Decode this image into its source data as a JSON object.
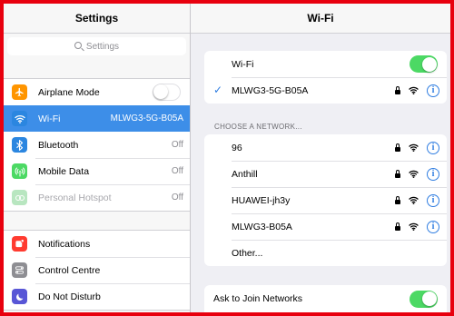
{
  "sidebar": {
    "title": "Settings",
    "search_placeholder": "Settings",
    "group1": [
      {
        "label": "Airplane Mode",
        "value": "",
        "icon": "airplane-icon",
        "color": "#ff9500",
        "toggle": "off"
      },
      {
        "label": "Wi-Fi",
        "value": "MLWG3-5G-B05A",
        "icon": "wifi-icon",
        "color": "#2b86e0",
        "selected": true
      },
      {
        "label": "Bluetooth",
        "value": "Off",
        "icon": "bluetooth-icon",
        "color": "#2b86e0"
      },
      {
        "label": "Mobile Data",
        "value": "Off",
        "icon": "antenna-icon",
        "color": "#4cd964"
      },
      {
        "label": "Personal Hotspot",
        "value": "Off",
        "icon": "hotspot-icon",
        "color": "#b8e6c0",
        "disabled": true
      }
    ],
    "group2": [
      {
        "label": "Notifications",
        "icon": "notifications-icon",
        "color": "#ff3b30"
      },
      {
        "label": "Control Centre",
        "icon": "control-centre-icon",
        "color": "#8e8e93"
      },
      {
        "label": "Do Not Disturb",
        "icon": "moon-icon",
        "color": "#5856d6"
      }
    ]
  },
  "wifi_panel": {
    "title": "Wi-Fi",
    "wifi_label": "Wi-Fi",
    "wifi_toggle": "on",
    "connected_network": "MLWG3-5G-B05A",
    "choose_title": "CHOOSE A NETWORK...",
    "networks": [
      "96",
      "Anthill",
      "HUAWEI-jh3y",
      "MLWG3-B05A"
    ],
    "other_label": "Other...",
    "ask_label": "Ask to Join Networks",
    "ask_toggle": "on",
    "info_glyph": "i"
  },
  "colors": {
    "accent": "#2f7de1",
    "toggle_on": "#4cd964",
    "selected_row": "#3d8ee8",
    "frame": "#e8000e"
  }
}
